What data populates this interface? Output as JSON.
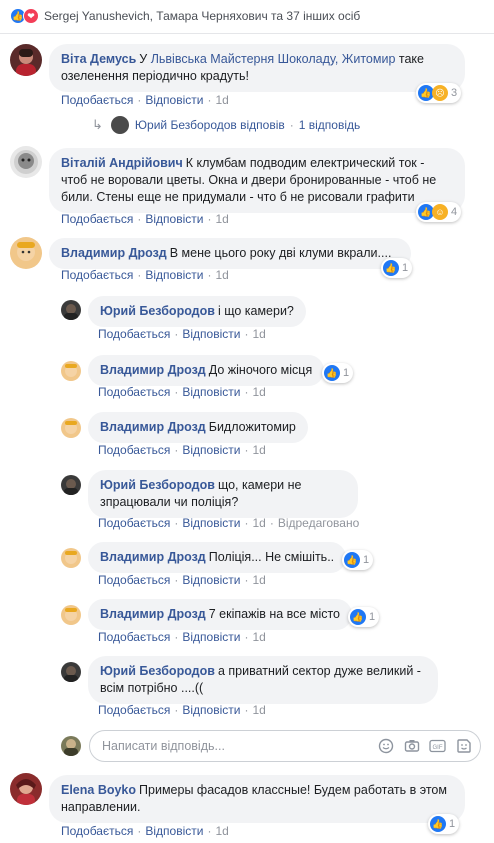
{
  "summary": {
    "text": "Sergej Yanushevich, Тамара Черняхович та 37 інших осіб"
  },
  "labels": {
    "like": "Подобається",
    "reply": "Відповісти",
    "dot": "·",
    "edited": "Відредаговано"
  },
  "comments": [
    {
      "name": "Віта Демусь",
      "text_prefix": "У ",
      "link": "Львівська Майстерня Шоколаду, Житомир",
      "text_suffix": " таке озеленення періодично крадуть!",
      "time": "1d",
      "reaction_count": "3",
      "reactions": [
        "like-icon",
        "sad-icon"
      ]
    },
    {
      "name": "Віталій Андрійович",
      "text": "К клумбам подводим електрический ток - чтоб не воровали цветы. Окна и двери бронированные - чтоб не били. Стены еще не придумали - что б не рисовали графити",
      "time": "1d",
      "reaction_count": "4",
      "reactions": [
        "like-icon",
        "haha-icon"
      ]
    },
    {
      "name": "Владимир Дрозд",
      "text": "В мене цього року дві клуми вкрали....",
      "time": "1d",
      "reaction_count": "1"
    },
    {
      "name": "Elena Boyko",
      "text": "Примеры фасадов классные! Будем работать в этом направлении.",
      "time": "1d",
      "reaction_count": "1"
    }
  ],
  "reply_summary": {
    "author": "Юрий Безбородов відповів",
    "count": "1 відповідь"
  },
  "replies": [
    {
      "name": "Юрий Безбородов",
      "text": "і що камери?",
      "time": "1d"
    },
    {
      "name": "Владимир Дрозд",
      "text": "До жіночого місця",
      "time": "1d",
      "reaction_count": "1"
    },
    {
      "name": "Владимир Дрозд",
      "text": "Бидложитомир",
      "time": "1d"
    },
    {
      "name": "Юрий Безбородов",
      "text": "що, камери не зпрацювали чи поліція?",
      "time": "1d"
    },
    {
      "name": "Владимир Дрозд",
      "text": "Поліція... Не смішіть..",
      "time": "1d",
      "reaction_count": "1"
    },
    {
      "name": "Владимир Дрозд",
      "text": "7 екіпажів на все місто",
      "time": "1d",
      "reaction_count": "1"
    },
    {
      "name": "Юрий Безбородов",
      "text": "а приватний сектор дуже великий - всім потрібно ....((",
      "time": "1d"
    }
  ],
  "composer": {
    "placeholder": "Написати відповідь..."
  },
  "colors": {
    "link": "#385898",
    "bubble": "#f2f3f5",
    "like": "#2078f4"
  }
}
